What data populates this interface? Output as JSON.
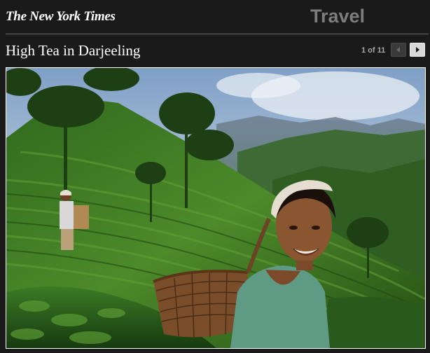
{
  "header": {
    "logo_text": "The New York Times",
    "section_label": "Travel"
  },
  "slideshow": {
    "title": "High Tea in Darjeeling",
    "counter": "1 of 11",
    "prev_icon": "chevron-left-icon",
    "next_icon": "chevron-right-icon"
  },
  "colors": {
    "background": "#1a1a1a",
    "section_label": "#7d7d7d",
    "tea_green": "#3f7a22",
    "sky": "#a9c3dd"
  }
}
